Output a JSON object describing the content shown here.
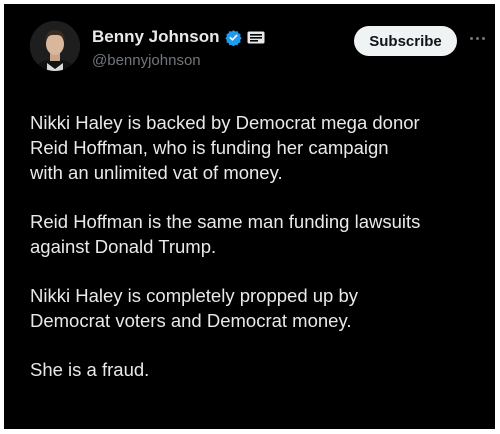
{
  "author": {
    "display_name": "Benny Johnson",
    "handle": "@bennyjohnson",
    "verified_badge": "verified-check-icon",
    "affiliate_badge": "affiliate-badge-icon",
    "verified_color": "#1d9bf0"
  },
  "actions": {
    "subscribe_label": "Subscribe",
    "more_icon": "more-options-icon"
  },
  "tweet": {
    "paragraphs": [
      "Nikki Haley is backed by Democrat mega donor\nReid Hoffman, who is funding her campaign\nwith an unlimited vat of money.",
      "Reid Hoffman is the same man funding lawsuits\nagainst Donald Trump.",
      "Nikki Haley is completely propped up by\nDemocrat voters and Democrat money.",
      "She is a fraud."
    ]
  },
  "colors": {
    "background": "#000000",
    "text": "#e7e9ea",
    "secondary_text": "#71767b",
    "button_bg": "#eff3f4"
  }
}
